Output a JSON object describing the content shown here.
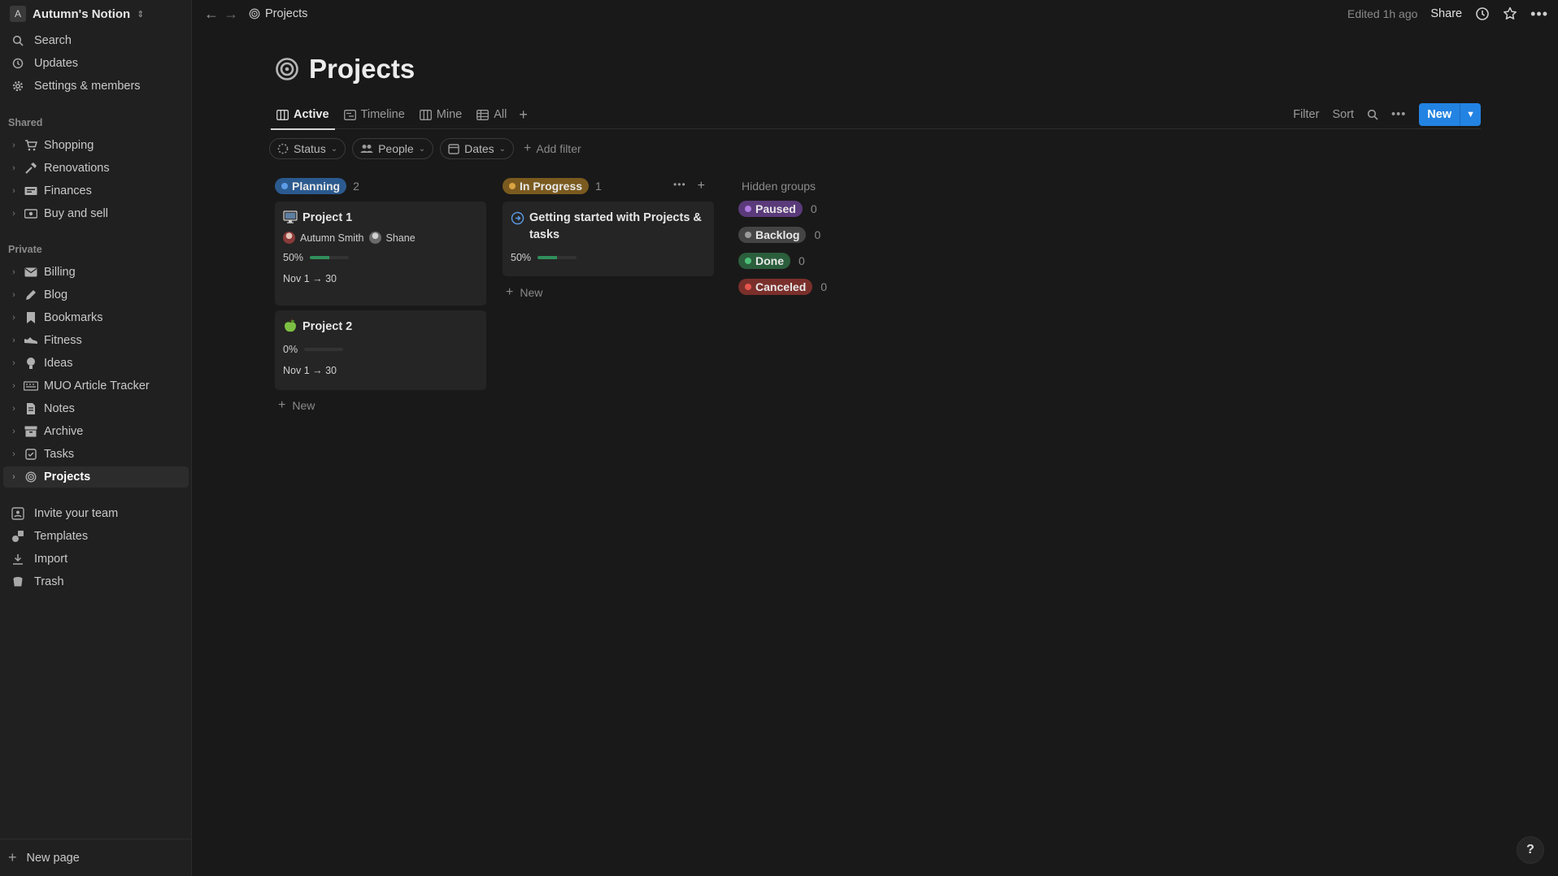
{
  "workspace": {
    "avatar_letter": "A",
    "name": "Autumn's Notion"
  },
  "sidebar": {
    "top_items": [
      {
        "label": "Search",
        "icon": "search-icon"
      },
      {
        "label": "Updates",
        "icon": "clock-icon"
      },
      {
        "label": "Settings & members",
        "icon": "gear-icon"
      }
    ],
    "shared_label": "Shared",
    "shared_items": [
      {
        "label": "Shopping",
        "icon": "cart-icon"
      },
      {
        "label": "Renovations",
        "icon": "hammer-icon"
      },
      {
        "label": "Finances",
        "icon": "money-icon"
      },
      {
        "label": "Buy and sell",
        "icon": "cash-icon"
      }
    ],
    "private_label": "Private",
    "private_items": [
      {
        "label": "Billing",
        "icon": "mail-icon"
      },
      {
        "label": "Blog",
        "icon": "pencil-icon"
      },
      {
        "label": "Bookmarks",
        "icon": "bookmark-icon"
      },
      {
        "label": "Fitness",
        "icon": "shoe-icon"
      },
      {
        "label": "Ideas",
        "icon": "lightbulb-icon"
      },
      {
        "label": "MUO Article Tracker",
        "icon": "keyboard-icon"
      },
      {
        "label": "Notes",
        "icon": "document-icon"
      },
      {
        "label": "Archive",
        "icon": "archive-icon"
      },
      {
        "label": "Tasks",
        "icon": "checkbox-icon"
      },
      {
        "label": "Projects",
        "icon": "target-icon",
        "active": true
      }
    ],
    "bottom_items": [
      {
        "label": "Invite your team",
        "icon": "invite-icon"
      },
      {
        "label": "Templates",
        "icon": "templates-icon"
      },
      {
        "label": "Import",
        "icon": "import-icon"
      },
      {
        "label": "Trash",
        "icon": "trash-icon"
      }
    ],
    "new_page_label": "New page"
  },
  "topbar": {
    "breadcrumb": "Projects",
    "edited": "Edited 1h ago",
    "share": "Share"
  },
  "page": {
    "title": "Projects",
    "views": [
      {
        "label": "Active",
        "icon": "board-icon",
        "active": true
      },
      {
        "label": "Timeline",
        "icon": "timeline-icon"
      },
      {
        "label": "Mine",
        "icon": "board-icon"
      },
      {
        "label": "All",
        "icon": "table-icon"
      }
    ],
    "tools": {
      "filter": "Filter",
      "sort": "Sort",
      "new": "New"
    },
    "filters": [
      {
        "label": "Status",
        "icon": "status-icon"
      },
      {
        "label": "People",
        "icon": "people-icon"
      },
      {
        "label": "Dates",
        "icon": "calendar-icon"
      }
    ],
    "add_filter": "Add filter"
  },
  "board": {
    "columns": [
      {
        "name": "Planning",
        "count": "2",
        "color": "#2b5a8f",
        "dot": "#5b9be6",
        "cards": [
          {
            "title": "Project 1",
            "icon": "monitor-icon",
            "people": [
              "Autumn Smith",
              "Shane"
            ],
            "progress_label": "50%",
            "progress": 0.5,
            "dates": "Nov 1 → 30"
          },
          {
            "title": "Project 2",
            "icon": "apple-icon",
            "people": [],
            "progress_label": "0%",
            "progress": 0,
            "dates": "Nov 1 → 30"
          }
        ],
        "new_label": "New"
      },
      {
        "name": "In Progress",
        "count": "1",
        "color": "#7a5a1f",
        "dot": "#d9a441",
        "cards": [
          {
            "title": "Getting started with Projects & tasks",
            "icon": "arrow-circle-icon",
            "progress_label": "50%",
            "progress": 0.5
          }
        ],
        "new_label": "New"
      }
    ],
    "hidden_title": "Hidden groups",
    "hidden_groups": [
      {
        "name": "Paused",
        "count": "0",
        "color": "#5a3a7a",
        "dot": "#b07be0"
      },
      {
        "name": "Backlog",
        "count": "0",
        "color": "#444444",
        "dot": "#9b9b9b"
      },
      {
        "name": "Done",
        "count": "0",
        "color": "#2b5e3c",
        "dot": "#4cbf78"
      },
      {
        "name": "Canceled",
        "count": "0",
        "color": "#7a2f2b",
        "dot": "#e5574e"
      }
    ]
  },
  "help": "?"
}
